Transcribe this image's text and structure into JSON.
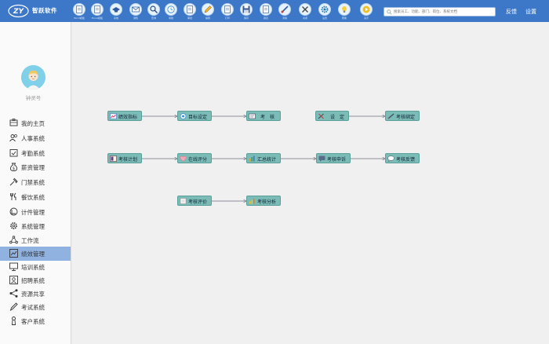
{
  "app": {
    "brand": "智跃软件"
  },
  "toolbar": [
    {
      "icon": "document-icon",
      "label": "Word模板"
    },
    {
      "icon": "document-icon",
      "label": "Excel模板"
    },
    {
      "icon": "hat-icon",
      "label": "系统"
    },
    {
      "icon": "mail-icon",
      "label": "通知"
    },
    {
      "icon": "search-icon",
      "label": "查询"
    },
    {
      "icon": "clock-icon",
      "label": "考勤"
    },
    {
      "icon": "document-icon",
      "label": "审批"
    },
    {
      "icon": "pencil-icon",
      "label": "编辑"
    },
    {
      "icon": "document-icon",
      "label": "打印"
    },
    {
      "icon": "save-icon",
      "label": "保存"
    },
    {
      "icon": "document-icon",
      "label": "报表"
    },
    {
      "icon": "brush-icon",
      "label": "清除"
    },
    {
      "icon": "close-icon",
      "label": "关闭"
    },
    {
      "icon": "gear-icon",
      "label": "设置"
    },
    {
      "icon": "lightbulb-icon",
      "label": "帮助"
    },
    {
      "icon": "play-icon",
      "label": "演示"
    }
  ],
  "search": {
    "placeholder": "搜索员工、功能、部门、岗位、系统文档"
  },
  "top_links": {
    "feedback": "反馈",
    "settings": "设置"
  },
  "user": {
    "name": "钟灵号"
  },
  "sidebar": {
    "active": 9,
    "items": [
      {
        "icon": "home-icon",
        "label": "我的主页"
      },
      {
        "icon": "people-icon",
        "label": "人事系统"
      },
      {
        "icon": "calendar-check-icon",
        "label": "考勤系统"
      },
      {
        "icon": "money-bag-icon",
        "label": "薪资管理"
      },
      {
        "icon": "door-access-icon",
        "label": "门禁系统"
      },
      {
        "icon": "utensils-icon",
        "label": "餐饮系统"
      },
      {
        "icon": "piecework-icon",
        "label": "计件管理"
      },
      {
        "icon": "gear-icon",
        "label": "系统管理"
      },
      {
        "icon": "workflow-icon",
        "label": "工作流"
      },
      {
        "icon": "chart-icon",
        "label": "绩效管理"
      },
      {
        "icon": "training-icon",
        "label": "培训系统"
      },
      {
        "icon": "recruit-icon",
        "label": "招聘系统"
      },
      {
        "icon": "share-icon",
        "label": "资源共享"
      },
      {
        "icon": "pen-icon",
        "label": "考试系统"
      },
      {
        "icon": "customer-icon",
        "label": "客户系统"
      }
    ]
  },
  "flow": {
    "indicators": "绩效指标",
    "goal_setting": "目标设定",
    "evaluation": "考　核",
    "setup": "设　定",
    "binding": "考核绑定",
    "plan": "考核计划",
    "online_scoring": "在线评分",
    "summary": "汇总统计",
    "appeal": "考核申诉",
    "feedback": "考核反馈",
    "review": "考核评价",
    "analysis": "考核分析"
  }
}
